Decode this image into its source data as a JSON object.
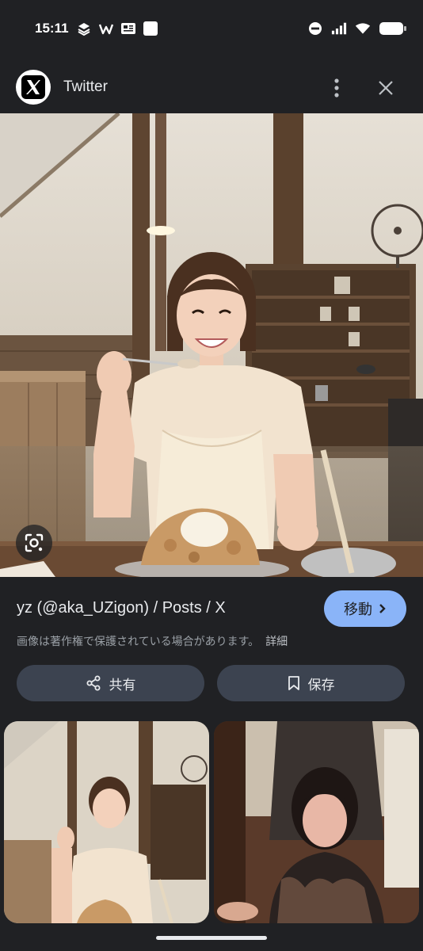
{
  "status_bar": {
    "time": "15:11",
    "left_icons": [
      "stack-icon",
      "w-app-icon",
      "news-icon",
      "square-icon"
    ],
    "right_icons": [
      "do-not-disturb-icon",
      "signal-icon",
      "wifi-icon",
      "battery-icon"
    ]
  },
  "header": {
    "source_name": "Twitter",
    "logo_icon": "x-logo-icon"
  },
  "result": {
    "title": "yz (@aka_UZigon) / Posts / X",
    "visit_label": "移動",
    "copyright_notice": "画像は著作権で保護されている場合があります。",
    "details_link": "詳細"
  },
  "actions": {
    "share_label": "共有",
    "save_label": "保存"
  },
  "colors": {
    "background": "#202124",
    "accent": "#8ab4f8",
    "button_bg": "#3c4350",
    "text": "#e8eaed",
    "secondary_text": "#9aa0a6"
  }
}
